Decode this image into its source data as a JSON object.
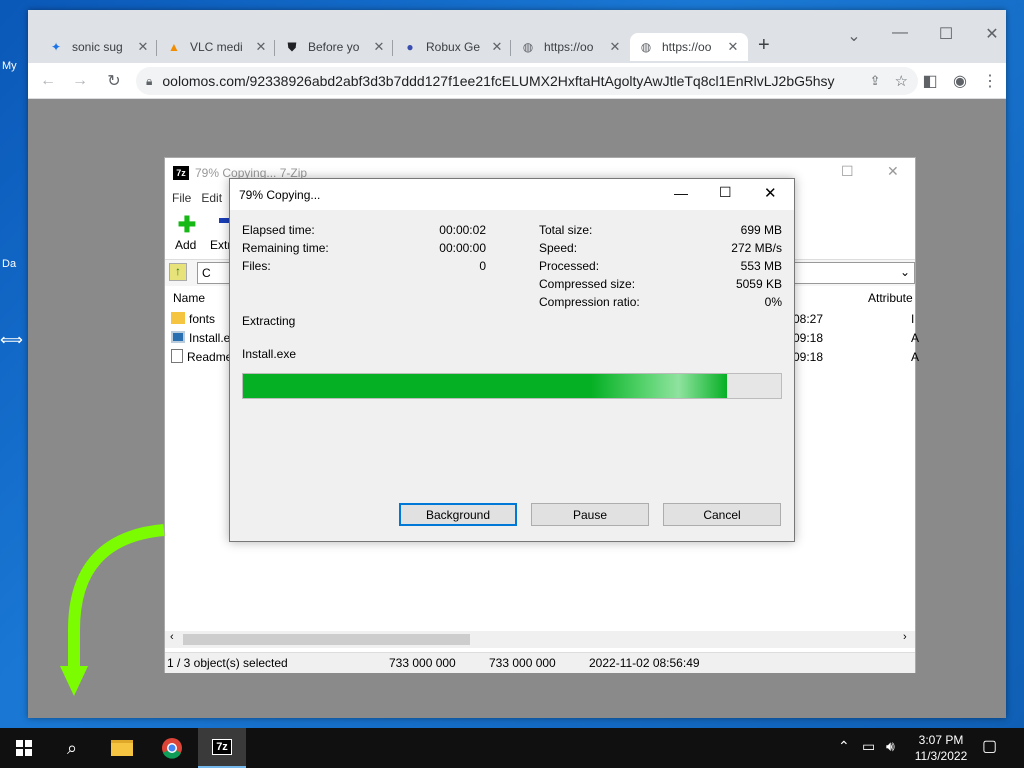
{
  "desktop": {
    "icon_labels": [
      "My",
      "Da"
    ]
  },
  "browser": {
    "tabs": [
      {
        "title": "sonic sug",
        "icon": "puzzle-icon"
      },
      {
        "title": "VLC medi",
        "icon": "vlc-cone-icon"
      },
      {
        "title": "Before yo",
        "icon": "shield-icon"
      },
      {
        "title": "Robux Ge",
        "icon": "planet-icon"
      },
      {
        "title": "https://oo",
        "icon": "globe-icon"
      },
      {
        "title": "https://oo",
        "icon": "globe-icon",
        "active": true
      }
    ],
    "new_tab": "+",
    "url": "oolomos.com/92338926abd2abf3d3b7ddd127f1ee21fcELUMX2HxftaHtAgoltyAwJtleTq8cl1EnRlvLJ2bG5hsy"
  },
  "zip_window": {
    "title": "79% Copying... 7-Zip",
    "logo": "7z",
    "menu": [
      "File",
      "Edit"
    ],
    "toolbar": {
      "add": "Add",
      "extract": "Extr"
    },
    "address": "C",
    "columns": {
      "name": "Name",
      "attributes": "Attribute"
    },
    "files": [
      {
        "name": "fonts",
        "time": "08:27",
        "attr": "I",
        "icon": "folder-icon"
      },
      {
        "name": "Install.ex",
        "time": "09:18",
        "attr": "A",
        "icon": "exe-icon"
      },
      {
        "name": "Readme",
        "time": "09:18",
        "attr": "A",
        "icon": "text-file-icon"
      }
    ],
    "status": {
      "selection": "1 / 3 object(s) selected",
      "size": "733 000 000",
      "packed": "733 000 000",
      "modified": "2022-11-02 08:56:49"
    }
  },
  "progress_dialog": {
    "title": "79% Copying...",
    "left_stats": [
      {
        "label": "Elapsed time:",
        "value": "00:00:02"
      },
      {
        "label": "Remaining time:",
        "value": "00:00:00"
      },
      {
        "label": "Files:",
        "value": "0"
      }
    ],
    "right_stats": [
      {
        "label": "Total size:",
        "value": "699 MB"
      },
      {
        "label": "Speed:",
        "value": "272 MB/s"
      },
      {
        "label": "Processed:",
        "value": "553 MB"
      },
      {
        "label": "Compressed size:",
        "value": "5059 KB"
      },
      {
        "label": "Compression ratio:",
        "value": "0%"
      }
    ],
    "operation": "Extracting",
    "current_file": "Install.exe",
    "progress": 0.9,
    "buttons": {
      "background": "Background",
      "pause": "Pause",
      "cancel": "Cancel"
    }
  },
  "taskbar": {
    "time": "3:07 PM",
    "date": "11/3/2022",
    "pinned_zip": "7z"
  },
  "colors": {
    "progress_green": "#06b025",
    "arrow_green": "#7cfc00",
    "accent_blue": "#0078d7"
  }
}
